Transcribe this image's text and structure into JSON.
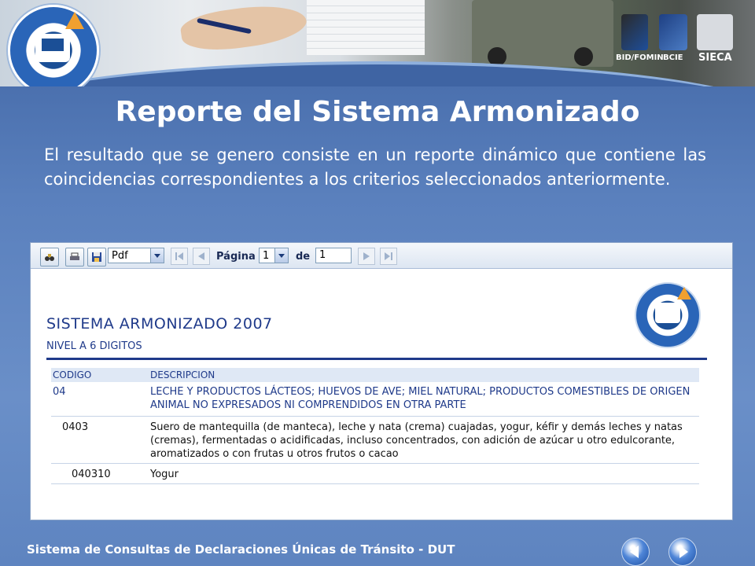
{
  "slide": {
    "title": "Reporte del Sistema Armonizado",
    "description": "El resultado que se genero consiste en un reporte dinámico que contiene las coincidencias correspondientes a los criterios seleccionados anteriormente.",
    "footer": "Sistema de Consultas de Declaraciones Únicas de Tránsito - DUT"
  },
  "partners": [
    "BID/FOMIN",
    "BCIE",
    "SIECA"
  ],
  "toolbar": {
    "format_value": "Pdf",
    "page_label": "Página",
    "page_value": "1",
    "of_label": "de",
    "total_pages": "1"
  },
  "report": {
    "title": "SISTEMA ARMONIZADO 2007",
    "subtitle": "NIVEL A 6 DIGITOS",
    "columns": [
      "CODIGO",
      "DESCRIPCION"
    ],
    "rows": [
      {
        "code": "04",
        "description": "LECHE Y PRODUCTOS LÁCTEOS; HUEVOS DE AVE; MIEL NATURAL; PRODUCTOS COMESTIBLES DE ORIGEN ANIMAL NO EXPRESADOS NI COMPRENDIDOS EN OTRA PARTE"
      },
      {
        "code": "0403",
        "description": "Suero de mantequilla (de manteca), leche y nata (crema) cuajadas, yogur, kéfir y demás leches y natas (cremas), fermentadas o acidificadas, incluso concentrados, con adición de azúcar u otro edulcorante, aromatizados o con frutas u otros frutos o cacao"
      },
      {
        "code": "040310",
        "description": "Yogur"
      }
    ]
  },
  "colors": {
    "slide_blue": "#4e73ae",
    "report_text": "#1f3a8a",
    "header_band": "#dfe8f5"
  },
  "icons": [
    "binoculars-icon",
    "print-icon",
    "save-icon",
    "first-page-icon",
    "prev-page-icon",
    "next-page-icon",
    "last-page-icon",
    "previous-slide-icon",
    "next-slide-icon"
  ]
}
